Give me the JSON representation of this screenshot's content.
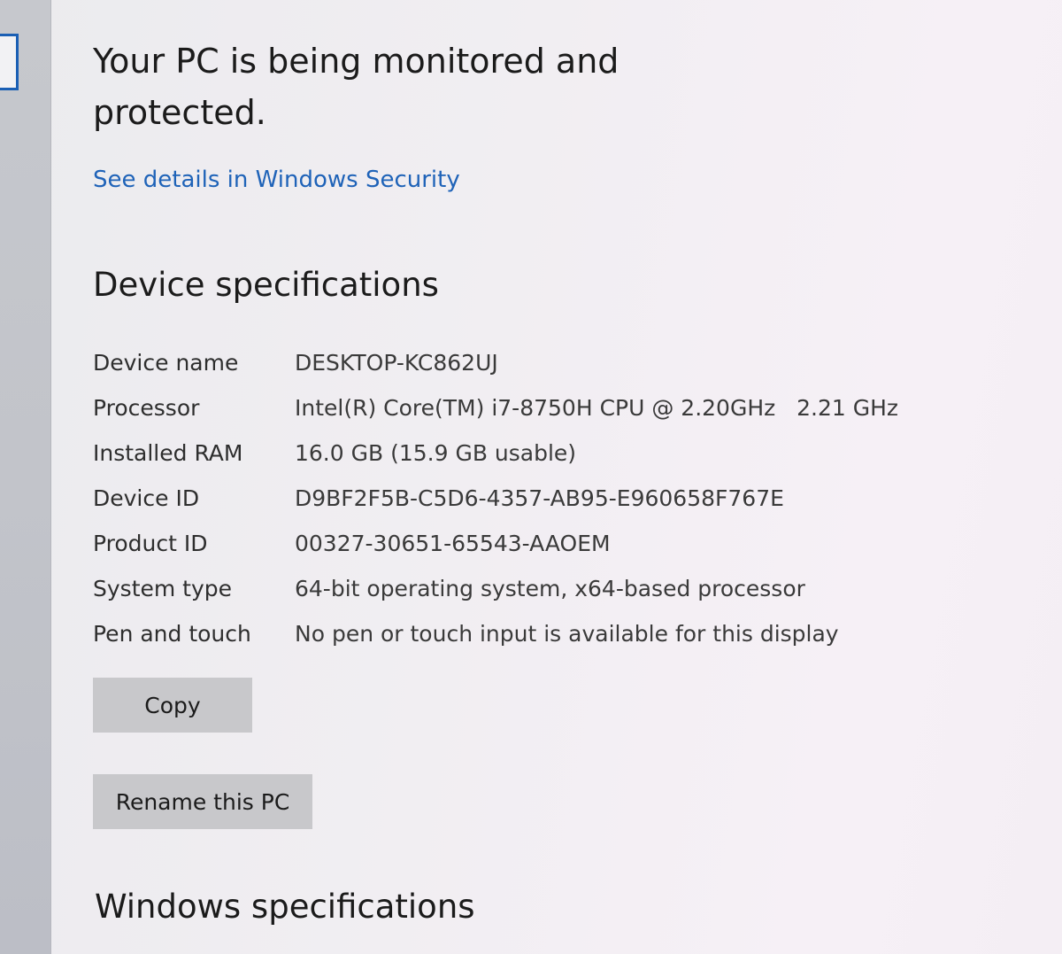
{
  "protection": {
    "status_text": "Your PC is being monitored and protected.",
    "details_link": "See details in Windows Security"
  },
  "device_specifications": {
    "title": "Device specifications",
    "rows": [
      {
        "label": "Device name",
        "value": "DESKTOP-KC862UJ"
      },
      {
        "label": "Processor",
        "value": "Intel(R) Core(TM) i7-8750H CPU @ 2.20GHz   2.21 GHz"
      },
      {
        "label": "Installed RAM",
        "value": "16.0 GB (15.9 GB usable)"
      },
      {
        "label": "Device ID",
        "value": "D9BF2F5B-C5D6-4357-AB95-E960658F767E"
      },
      {
        "label": "Product ID",
        "value": "00327-30651-65543-AAOEM"
      },
      {
        "label": "System type",
        "value": "64-bit operating system, x64-based processor"
      },
      {
        "label": "Pen and touch",
        "value": "No pen or touch input is available for this display"
      }
    ],
    "copy_label": "Copy",
    "rename_label": "Rename this PC"
  },
  "windows_specifications": {
    "title": "Windows specifications"
  },
  "colors": {
    "link": "#1f63b8",
    "button_bg": "#c8c8cb",
    "sidebar_bg": "#c4c6cc",
    "focus_border": "#1a5fb4"
  }
}
